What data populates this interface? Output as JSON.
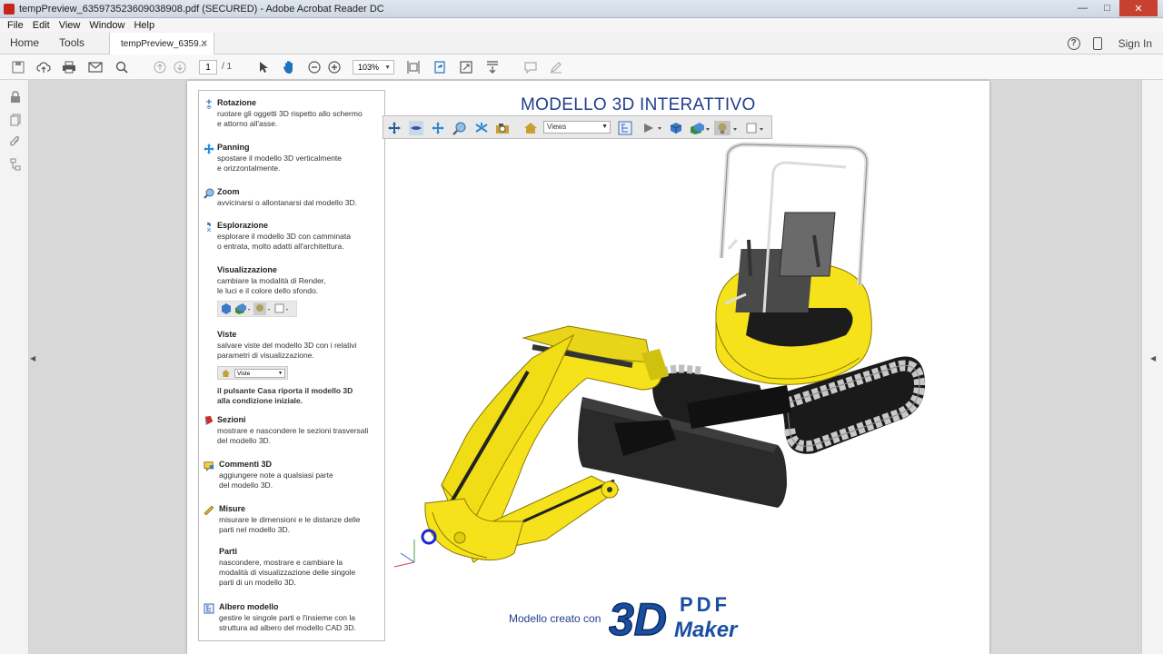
{
  "window": {
    "title": "tempPreview_635973523609038908.pdf (SECURED) - Adobe Acrobat Reader DC"
  },
  "menu": [
    "File",
    "Edit",
    "View",
    "Window",
    "Help"
  ],
  "tabs": {
    "home": "Home",
    "tools": "Tools",
    "document": "tempPreview_6359...",
    "signin": "Sign In"
  },
  "toolbar": {
    "page_current": "1",
    "page_total": "/ 1",
    "zoom": "103%"
  },
  "page": {
    "title": "MODELLO 3D INTERATTIVO",
    "footer": "Modello creato con",
    "logo_text": "3D PDF Maker"
  },
  "toolbar3d": {
    "views_label": "Views"
  },
  "help": {
    "rotazione": {
      "title": "Rotazione",
      "lines": [
        "ruotare gli oggetti 3D rispetto allo schermo",
        "e attorno all'asse."
      ]
    },
    "panning": {
      "title": "Panning",
      "lines": [
        "spostare il modello 3D verticalmente",
        "e orizzontalmente."
      ]
    },
    "zoom": {
      "title": "Zoom",
      "lines": [
        "avvicinarsi o allontanarsi dal modello 3D."
      ]
    },
    "esplorazione": {
      "title": "Esplorazione",
      "lines": [
        "esplorare il modello 3D con camminata",
        "o entrata, molto adatti all'architettura."
      ]
    },
    "visualizzazione": {
      "title": "Visualizzazione",
      "lines": [
        "cambiare la modalità di Render,",
        "le luci e il colore dello sfondo."
      ]
    },
    "viste": {
      "title": "Viste",
      "lines": [
        "salvare viste del modello 3D con i relativi",
        "parametri di visualizzazione."
      ],
      "dropdown": "Viste"
    },
    "casa": {
      "lines": [
        "il pulsante Casa riporta il modello 3D",
        "alla condizione iniziale."
      ]
    },
    "sezioni": {
      "title": "Sezioni",
      "lines": [
        "mostrare e nascondere le sezioni trasversali",
        "del modello 3D."
      ]
    },
    "commenti": {
      "title": "Commenti 3D",
      "lines": [
        "aggiungere note a qualsiasi parte",
        "del modello 3D."
      ]
    },
    "misure": {
      "title": "Misure",
      "lines": [
        "misurare le dimensioni e le distanze delle",
        "parti nel modello 3D."
      ]
    },
    "parti": {
      "title": "Parti",
      "lines": [
        "nascondere, mostrare e cambiare la",
        "modalità di visualizzazione delle singole",
        "parti di un modello 3D."
      ]
    },
    "albero": {
      "title": "Albero modello",
      "lines": [
        "gestire le singole parti e l'insieme con la",
        "struttura ad albero del modello CAD 3D."
      ]
    }
  },
  "colors": {
    "title_blue": "#223e8c",
    "excavator_yellow": "#f5e21a",
    "acrobat_red": "#c8261a"
  }
}
